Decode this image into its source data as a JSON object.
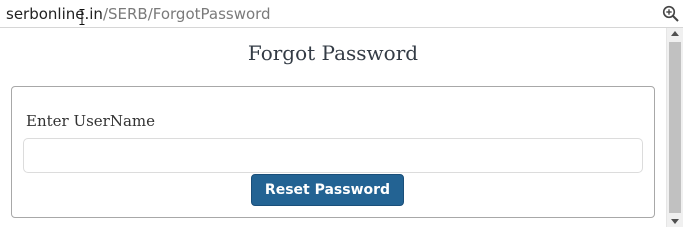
{
  "browser": {
    "url_host": "serbonline.in",
    "url_path": "/SERB/ForgotPassword",
    "zoom_icon": "zoom-in-icon",
    "cursor_icon": "text-cursor-icon"
  },
  "page": {
    "title": "Forgot Password",
    "form": {
      "username_label": "Enter UserName",
      "username_value": "",
      "username_placeholder": "",
      "submit_label": "Reset Password"
    }
  },
  "colors": {
    "button_bg": "#236393",
    "button_text": "#ffffff",
    "title_text": "#333b45",
    "panel_border": "#a8a8a8"
  }
}
